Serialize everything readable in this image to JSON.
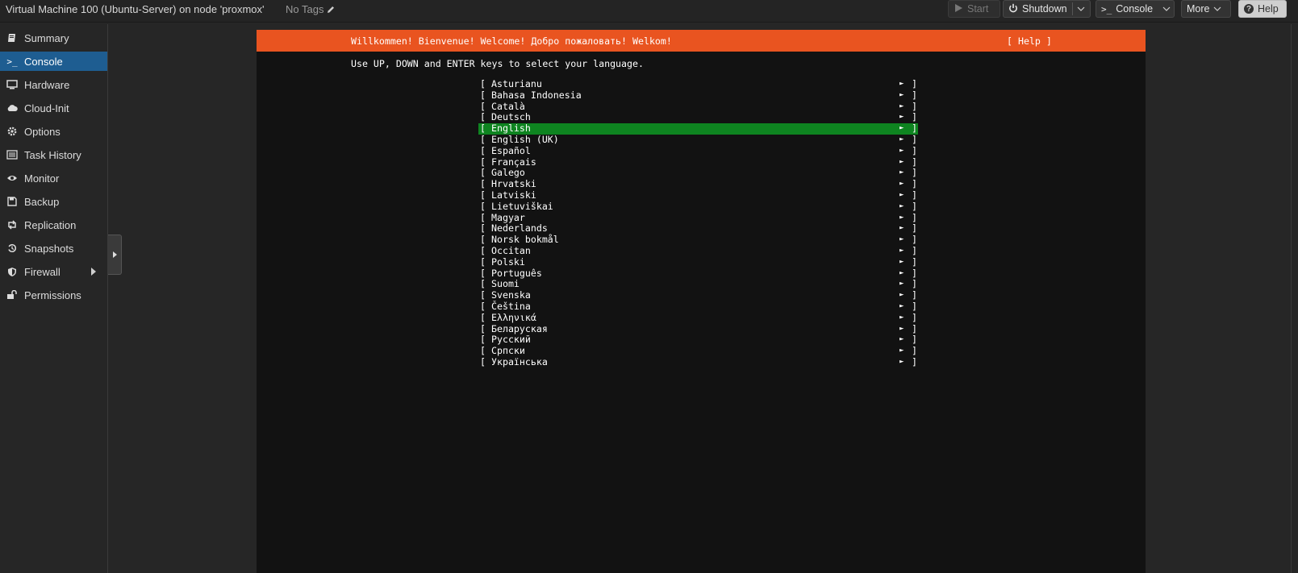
{
  "header": {
    "vm_title": "Virtual Machine 100 (Ubuntu-Server) on node 'proxmox'",
    "tags_label": "No Tags",
    "buttons": {
      "start": "Start",
      "shutdown": "Shutdown",
      "console": "Console",
      "more": "More",
      "help": "Help"
    }
  },
  "sidebar": {
    "items": [
      {
        "label": "Summary",
        "icon": "book-icon"
      },
      {
        "label": "Console",
        "icon": "terminal-icon",
        "active": true
      },
      {
        "label": "Hardware",
        "icon": "monitor-icon"
      },
      {
        "label": "Cloud-Init",
        "icon": "cloud-icon"
      },
      {
        "label": "Options",
        "icon": "gear-icon"
      },
      {
        "label": "Task History",
        "icon": "list-icon"
      },
      {
        "label": "Monitor",
        "icon": "eye-icon"
      },
      {
        "label": "Backup",
        "icon": "floppy-icon"
      },
      {
        "label": "Replication",
        "icon": "retweet-icon"
      },
      {
        "label": "Snapshots",
        "icon": "history-icon"
      },
      {
        "label": "Firewall",
        "icon": "shield-icon",
        "has_submenu": true
      },
      {
        "label": "Permissions",
        "icon": "unlock-icon"
      }
    ]
  },
  "console": {
    "header_text": "Willkommen! Bienvenue! Welcome! Добро пожаловать! Welkom!",
    "help_text": "[ Help ]",
    "instruction": "Use UP, DOWN and ENTER keys to select your language.",
    "selected_language": "English",
    "languages": [
      "Asturianu",
      "Bahasa Indonesia",
      "Català",
      "Deutsch",
      "English",
      "English (UK)",
      "Español",
      "Français",
      "Galego",
      "Hrvatski",
      "Latviski",
      "Lietuviškai",
      "Magyar",
      "Nederlands",
      "Norsk bokmål",
      "Occitan",
      "Polski",
      "Português",
      "Suomi",
      "Svenska",
      "Čeština",
      "Ελληνικά",
      "Беларуская",
      "Русский",
      "Српски",
      "Українська"
    ],
    "row_open": "[",
    "row_arrow": "►",
    "row_close": "]"
  },
  "colors": {
    "accent_active": "#1e5d91",
    "ubuntu_orange": "#e95420",
    "selection_green": "#0e8420"
  }
}
